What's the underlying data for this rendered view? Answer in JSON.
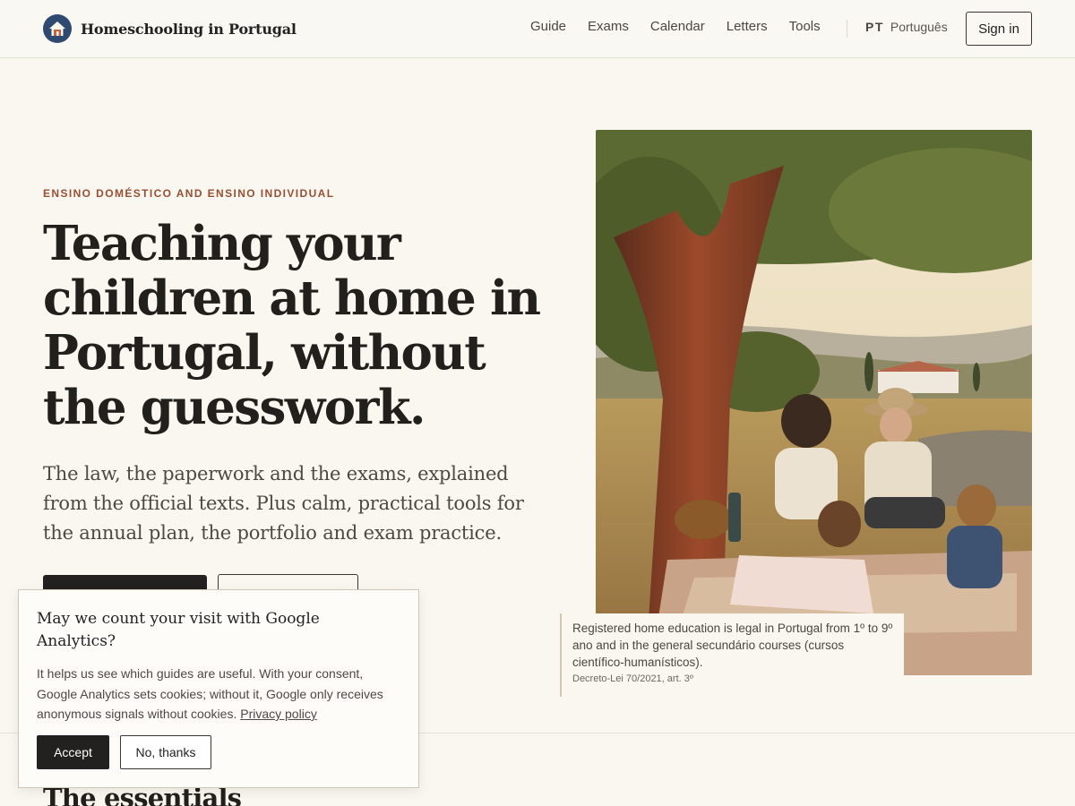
{
  "header": {
    "brand": "Homeschooling in Portugal",
    "nav": [
      "Guide",
      "Exams",
      "Calendar",
      "Letters",
      "Tools"
    ],
    "lang_code": "PT",
    "lang_name": "Português",
    "signin": "Sign in"
  },
  "hero": {
    "eyebrow": "ENSINO DOMÉSTICO AND ENSINO INDIVIDUAL",
    "title": "Teaching your children at home in Portugal, without the guesswork.",
    "subtitle": "The law, the paperwork and the exams, explained from the official texts. Plus calm, practical tools for the annual plan, the portfolio and exam practice."
  },
  "caption": {
    "text": "Registered home education is legal in Portugal from 1º to 9º ano and in the general secundário courses (cursos científico-humanísticos).",
    "source": "Decreto-Lei 70/2021, art. 3º"
  },
  "section": {
    "title": "The essentials"
  },
  "cookie": {
    "title": "May we count your visit with Google Analytics?",
    "body": "It helps us see which guides are useful. With your consent, Google Analytics sets cookies; without it, Google only receives anonymous signals without cookies.",
    "link": "Privacy policy",
    "accept": "Accept",
    "decline": "No, thanks"
  },
  "icons": {
    "logo": "house-icon"
  },
  "colors": {
    "accent": "#9a4f33",
    "brand": "#2f4a70",
    "dark_button": "#232120"
  }
}
